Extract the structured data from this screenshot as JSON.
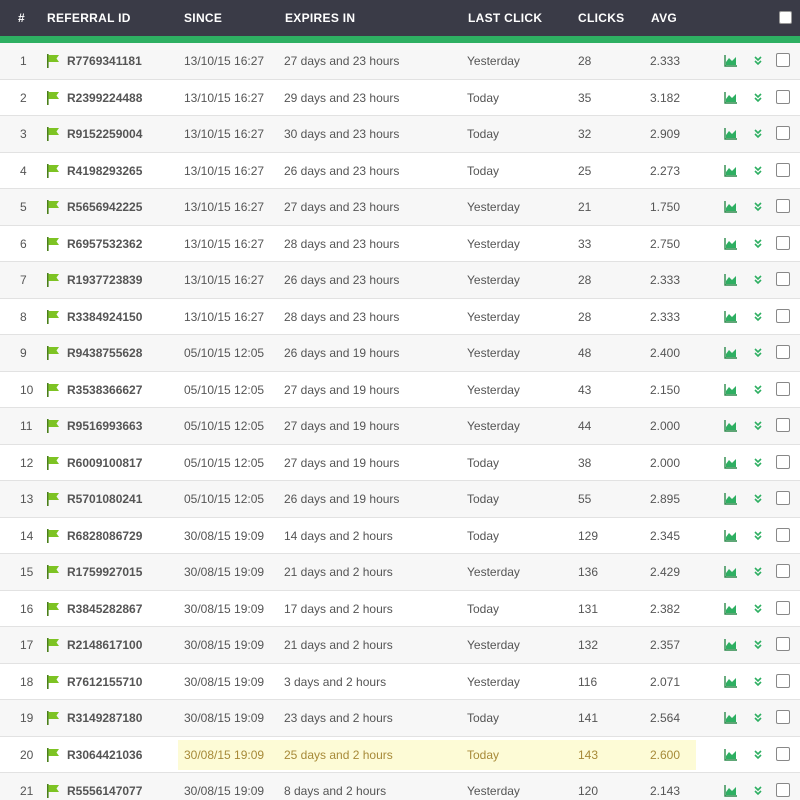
{
  "header": {
    "col_num": "#",
    "col_id": "REFERRAL ID",
    "col_since": "SINCE",
    "col_expires": "EXPIRES IN",
    "col_last": "LAST CLICK",
    "col_clicks": "CLICKS",
    "col_avg": "AVG"
  },
  "icons": {
    "flag": "flag-icon",
    "chart": "area-chart-icon",
    "chevron": "double-chevron-down-icon",
    "checkbox": "checkbox"
  },
  "colors": {
    "header_bg": "#3a3b47",
    "accent_green": "#2eaf62",
    "flag_green": "#7dc323",
    "highlight_bg": "#fdfbd6"
  },
  "highlighted_row": 20,
  "rows": [
    {
      "num": "1",
      "id": "R7769341181",
      "since": "13/10/15 16:27",
      "expires": "27 days and 23 hours",
      "last": "Yesterday",
      "clicks": "28",
      "avg": "2.333"
    },
    {
      "num": "2",
      "id": "R2399224488",
      "since": "13/10/15 16:27",
      "expires": "29 days and 23 hours",
      "last": "Today",
      "clicks": "35",
      "avg": "3.182"
    },
    {
      "num": "3",
      "id": "R9152259004",
      "since": "13/10/15 16:27",
      "expires": "30 days and 23 hours",
      "last": "Today",
      "clicks": "32",
      "avg": "2.909"
    },
    {
      "num": "4",
      "id": "R4198293265",
      "since": "13/10/15 16:27",
      "expires": "26 days and 23 hours",
      "last": "Today",
      "clicks": "25",
      "avg": "2.273"
    },
    {
      "num": "5",
      "id": "R5656942225",
      "since": "13/10/15 16:27",
      "expires": "27 days and 23 hours",
      "last": "Yesterday",
      "clicks": "21",
      "avg": "1.750"
    },
    {
      "num": "6",
      "id": "R6957532362",
      "since": "13/10/15 16:27",
      "expires": "28 days and 23 hours",
      "last": "Yesterday",
      "clicks": "33",
      "avg": "2.750"
    },
    {
      "num": "7",
      "id": "R1937723839",
      "since": "13/10/15 16:27",
      "expires": "26 days and 23 hours",
      "last": "Yesterday",
      "clicks": "28",
      "avg": "2.333"
    },
    {
      "num": "8",
      "id": "R3384924150",
      "since": "13/10/15 16:27",
      "expires": "28 days and 23 hours",
      "last": "Yesterday",
      "clicks": "28",
      "avg": "2.333"
    },
    {
      "num": "9",
      "id": "R9438755628",
      "since": "05/10/15 12:05",
      "expires": "26 days and 19 hours",
      "last": "Yesterday",
      "clicks": "48",
      "avg": "2.400"
    },
    {
      "num": "10",
      "id": "R3538366627",
      "since": "05/10/15 12:05",
      "expires": "27 days and 19 hours",
      "last": "Yesterday",
      "clicks": "43",
      "avg": "2.150"
    },
    {
      "num": "11",
      "id": "R9516993663",
      "since": "05/10/15 12:05",
      "expires": "27 days and 19 hours",
      "last": "Yesterday",
      "clicks": "44",
      "avg": "2.000"
    },
    {
      "num": "12",
      "id": "R6009100817",
      "since": "05/10/15 12:05",
      "expires": "27 days and 19 hours",
      "last": "Today",
      "clicks": "38",
      "avg": "2.000"
    },
    {
      "num": "13",
      "id": "R5701080241",
      "since": "05/10/15 12:05",
      "expires": "26 days and 19 hours",
      "last": "Today",
      "clicks": "55",
      "avg": "2.895"
    },
    {
      "num": "14",
      "id": "R6828086729",
      "since": "30/08/15 19:09",
      "expires": "14 days and 2 hours",
      "last": "Today",
      "clicks": "129",
      "avg": "2.345"
    },
    {
      "num": "15",
      "id": "R1759927015",
      "since": "30/08/15 19:09",
      "expires": "21 days and 2 hours",
      "last": "Yesterday",
      "clicks": "136",
      "avg": "2.429"
    },
    {
      "num": "16",
      "id": "R3845282867",
      "since": "30/08/15 19:09",
      "expires": "17 days and 2 hours",
      "last": "Today",
      "clicks": "131",
      "avg": "2.382"
    },
    {
      "num": "17",
      "id": "R2148617100",
      "since": "30/08/15 19:09",
      "expires": "21 days and 2 hours",
      "last": "Yesterday",
      "clicks": "132",
      "avg": "2.357"
    },
    {
      "num": "18",
      "id": "R7612155710",
      "since": "30/08/15 19:09",
      "expires": "3 days and 2 hours",
      "last": "Yesterday",
      "clicks": "116",
      "avg": "2.071"
    },
    {
      "num": "19",
      "id": "R3149287180",
      "since": "30/08/15 19:09",
      "expires": "23 days and 2 hours",
      "last": "Today",
      "clicks": "141",
      "avg": "2.564"
    },
    {
      "num": "20",
      "id": "R3064421036",
      "since": "30/08/15 19:09",
      "expires": "25 days and 2 hours",
      "last": "Today",
      "clicks": "143",
      "avg": "2.600"
    },
    {
      "num": "21",
      "id": "R5556147077",
      "since": "30/08/15 19:09",
      "expires": "8 days and 2 hours",
      "last": "Yesterday",
      "clicks": "120",
      "avg": "2.143"
    }
  ]
}
